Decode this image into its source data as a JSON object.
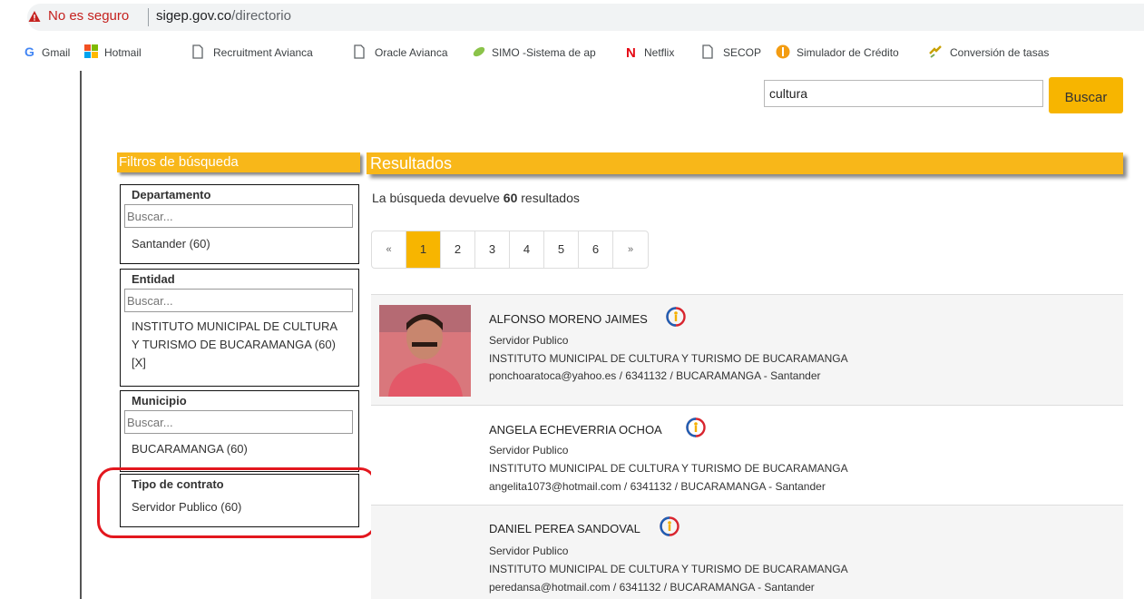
{
  "browser": {
    "security_label": "No es seguro",
    "url_domain": "sigep.gov.co",
    "url_path": "/directorio"
  },
  "bookmarks": [
    {
      "label": "Gmail",
      "icon": "google-icon"
    },
    {
      "label": "Hotmail",
      "icon": "microsoft-icon"
    },
    {
      "label": "Recruitment Avianca",
      "icon": "page-icon"
    },
    {
      "label": "Oracle Avianca",
      "icon": "page-icon"
    },
    {
      "label": "SIMO -Sistema de ap",
      "icon": "leaf-icon"
    },
    {
      "label": "Netflix",
      "icon": "netflix-icon"
    },
    {
      "label": "SECOP",
      "icon": "page-icon"
    },
    {
      "label": "Simulador de Crédito",
      "icon": "orange-circle-icon"
    },
    {
      "label": "Conversión de tasas",
      "icon": "arrows-icon"
    }
  ],
  "search": {
    "value": "cultura",
    "button_label": "Buscar"
  },
  "filters": {
    "title": "Filtros de búsqueda",
    "departamento": {
      "title": "Departamento",
      "placeholder": "Buscar...",
      "item": "Santander (60)"
    },
    "entidad": {
      "title": "Entidad",
      "placeholder": "Buscar...",
      "item_line1": "INSTITUTO MUNICIPAL DE CULTURA",
      "item_line2": "Y TURISMO DE BUCARAMANGA (60)",
      "item_line3": "[X]"
    },
    "municipio": {
      "title": "Municipio",
      "placeholder": "Buscar...",
      "item": "BUCARAMANGA (60)"
    },
    "tipo_contrato": {
      "title": "Tipo de contrato",
      "item": "Servidor Publico (60)"
    }
  },
  "results": {
    "title": "Resultados",
    "count_prefix": "La búsqueda devuelve ",
    "count": "60",
    "count_suffix": " resultados",
    "pagination": [
      "«",
      "1",
      "2",
      "3",
      "4",
      "5",
      "6",
      "»"
    ],
    "active_page": "1",
    "items": [
      {
        "name": "ALFONSO MORENO JAIMES",
        "role": "Servidor Publico",
        "entity": "INSTITUTO MUNICIPAL DE CULTURA Y TURISMO DE BUCARAMANGA",
        "contact": "ponchoaratoca@yahoo.es / 6341132 / BUCARAMANGA - Santander"
      },
      {
        "name": "ANGELA ECHEVERRIA OCHOA",
        "role": "Servidor Publico",
        "entity": "INSTITUTO MUNICIPAL DE CULTURA Y TURISMO DE BUCARAMANGA",
        "contact": "angelita1073@hotmail.com / 6341132 / BUCARAMANGA - Santander"
      },
      {
        "name": "DANIEL PEREA SANDOVAL",
        "role": "Servidor Publico",
        "entity": "INSTITUTO MUNICIPAL DE CULTURA Y TURISMO DE BUCARAMANGA",
        "contact": "peredansa@hotmail.com / 6341132 / BUCARAMANGA - Santander"
      }
    ]
  },
  "colors": {
    "accent": "#f7b500",
    "annotation": "#e3171e"
  }
}
